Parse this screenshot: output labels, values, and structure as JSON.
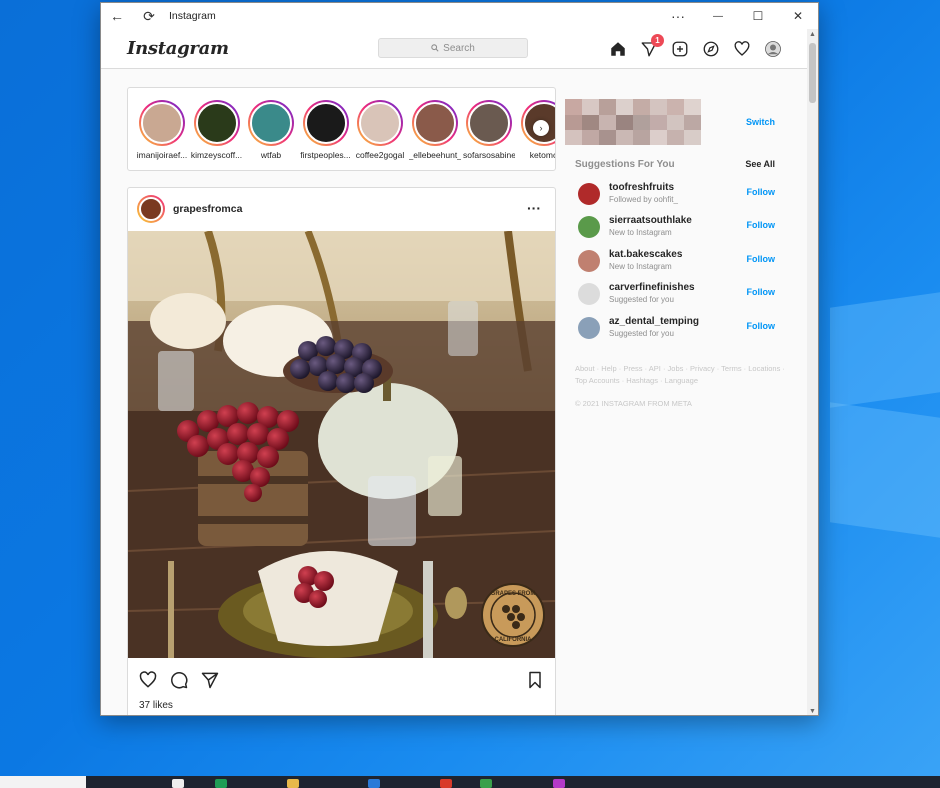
{
  "window": {
    "title": "Instagram",
    "back_glyph": "←",
    "refresh_glyph": "⟳",
    "more_glyph": "···",
    "minimize_glyph": "—",
    "maximize_glyph": "☐",
    "close_glyph": "✕"
  },
  "header": {
    "logo": "Instagram",
    "search_placeholder": "Search",
    "search_icon": "search-icon",
    "notification_count": "1",
    "icons": [
      "home-icon",
      "direct-messages-icon",
      "new-post-icon",
      "explore-icon",
      "activity-heart-icon",
      "profile-avatar"
    ]
  },
  "stories": [
    {
      "name": "imanijoiraef...",
      "color": "#c9a892"
    },
    {
      "name": "kimzeyscoff...",
      "color": "#2a3a1a"
    },
    {
      "name": "wtfab",
      "color": "#3a8a8a"
    },
    {
      "name": "firstpeoples...",
      "color": "#1a1a1a"
    },
    {
      "name": "coffee2gogal",
      "color": "#d9c4b8"
    },
    {
      "name": "_ellebeehunt_",
      "color": "#8a5a4a"
    },
    {
      "name": "sofarsosabine",
      "color": "#6a5a50"
    },
    {
      "name": "ketomc",
      "color": "#5a3a2a"
    }
  ],
  "post": {
    "username": "grapesfromca",
    "more_glyph": "···",
    "likes": "37 likes",
    "actions": [
      "like-heart-icon",
      "comment-icon",
      "share-icon",
      "bookmark-icon"
    ],
    "watermark_top": "GRAPES FROM",
    "watermark_bottom": "CALIFORNIA"
  },
  "sidebar": {
    "switch_label": "Switch",
    "suggestions_title": "Suggestions For You",
    "see_all": "See All",
    "suggestions": [
      {
        "username": "toofreshfruits",
        "subtitle": "Followed by oohfit_",
        "follow": "Follow",
        "color": "#b02a2a"
      },
      {
        "username": "sierraatsouthlake",
        "subtitle": "New to Instagram",
        "follow": "Follow",
        "color": "#5a9a4a"
      },
      {
        "username": "kat.bakescakes",
        "subtitle": "New to Instagram",
        "follow": "Follow",
        "color": "#c08070"
      },
      {
        "username": "carverfinefinishes",
        "subtitle": "Suggested for you",
        "follow": "Follow",
        "color": "#dcdcdc"
      },
      {
        "username": "az_dental_temping",
        "subtitle": "Suggested for you",
        "follow": "Follow",
        "color": "#8aa0b8"
      }
    ],
    "footer_links": "About · Help · Press · API · Jobs · Privacy · Terms · Locations · Top Accounts · Hashtags · Language",
    "copyright": "© 2021 INSTAGRAM FROM META"
  }
}
